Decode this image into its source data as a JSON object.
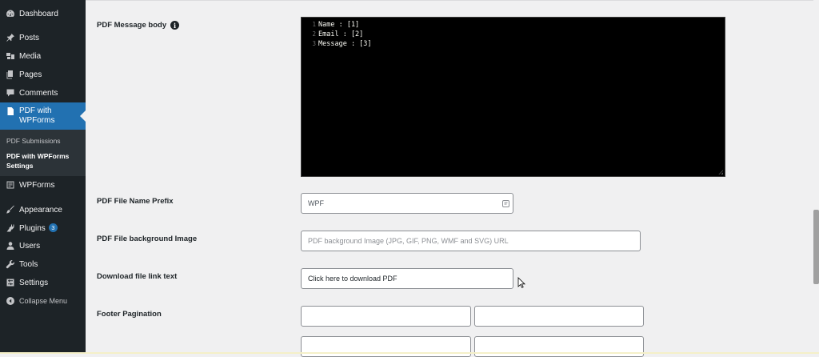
{
  "sidebar": {
    "items": [
      {
        "label": "Dashboard",
        "icon": "dashboard-icon"
      },
      {
        "label": "Posts",
        "icon": "pin-icon"
      },
      {
        "label": "Media",
        "icon": "media-icon"
      },
      {
        "label": "Pages",
        "icon": "pages-icon"
      },
      {
        "label": "Comments",
        "icon": "comment-icon"
      },
      {
        "label": "PDF with WPForms",
        "line1": "PDF with",
        "line2": "WPForms",
        "icon": "pdf-document-icon",
        "current": true
      },
      {
        "label": "WPForms",
        "icon": "form-icon"
      },
      {
        "label": "Appearance",
        "icon": "brush-icon"
      },
      {
        "label": "Plugins",
        "icon": "plugin-icon",
        "badge": "3"
      },
      {
        "label": "Users",
        "icon": "user-icon"
      },
      {
        "label": "Tools",
        "icon": "wrench-icon"
      },
      {
        "label": "Settings",
        "icon": "settings-icon"
      }
    ],
    "submenu": {
      "item1": "PDF Submissions",
      "item2_line1": "PDF with WPForms",
      "item2_line2": "Settings"
    },
    "collapse_label": "Collapse Menu",
    "accent_color": "#2271b1",
    "background_color": "#1d2327"
  },
  "form": {
    "message_body": {
      "label": "PDF Message body",
      "lines": [
        {
          "num": "1",
          "text": "Name : [1]"
        },
        {
          "num": "2",
          "text": "Email : [2]"
        },
        {
          "num": "3",
          "text": "Message : [3]"
        }
      ]
    },
    "file_name_prefix": {
      "label": "PDF File Name Prefix",
      "value": "WPF"
    },
    "background_image": {
      "label": "PDF File background Image",
      "placeholder": "PDF background Image (JPG, GIF, PNG, WMF and SVG) URL"
    },
    "download_link": {
      "label": "Download file link text",
      "value": "Click here to download PDF"
    },
    "footer_pagination": {
      "label": "Footer Pagination"
    }
  }
}
